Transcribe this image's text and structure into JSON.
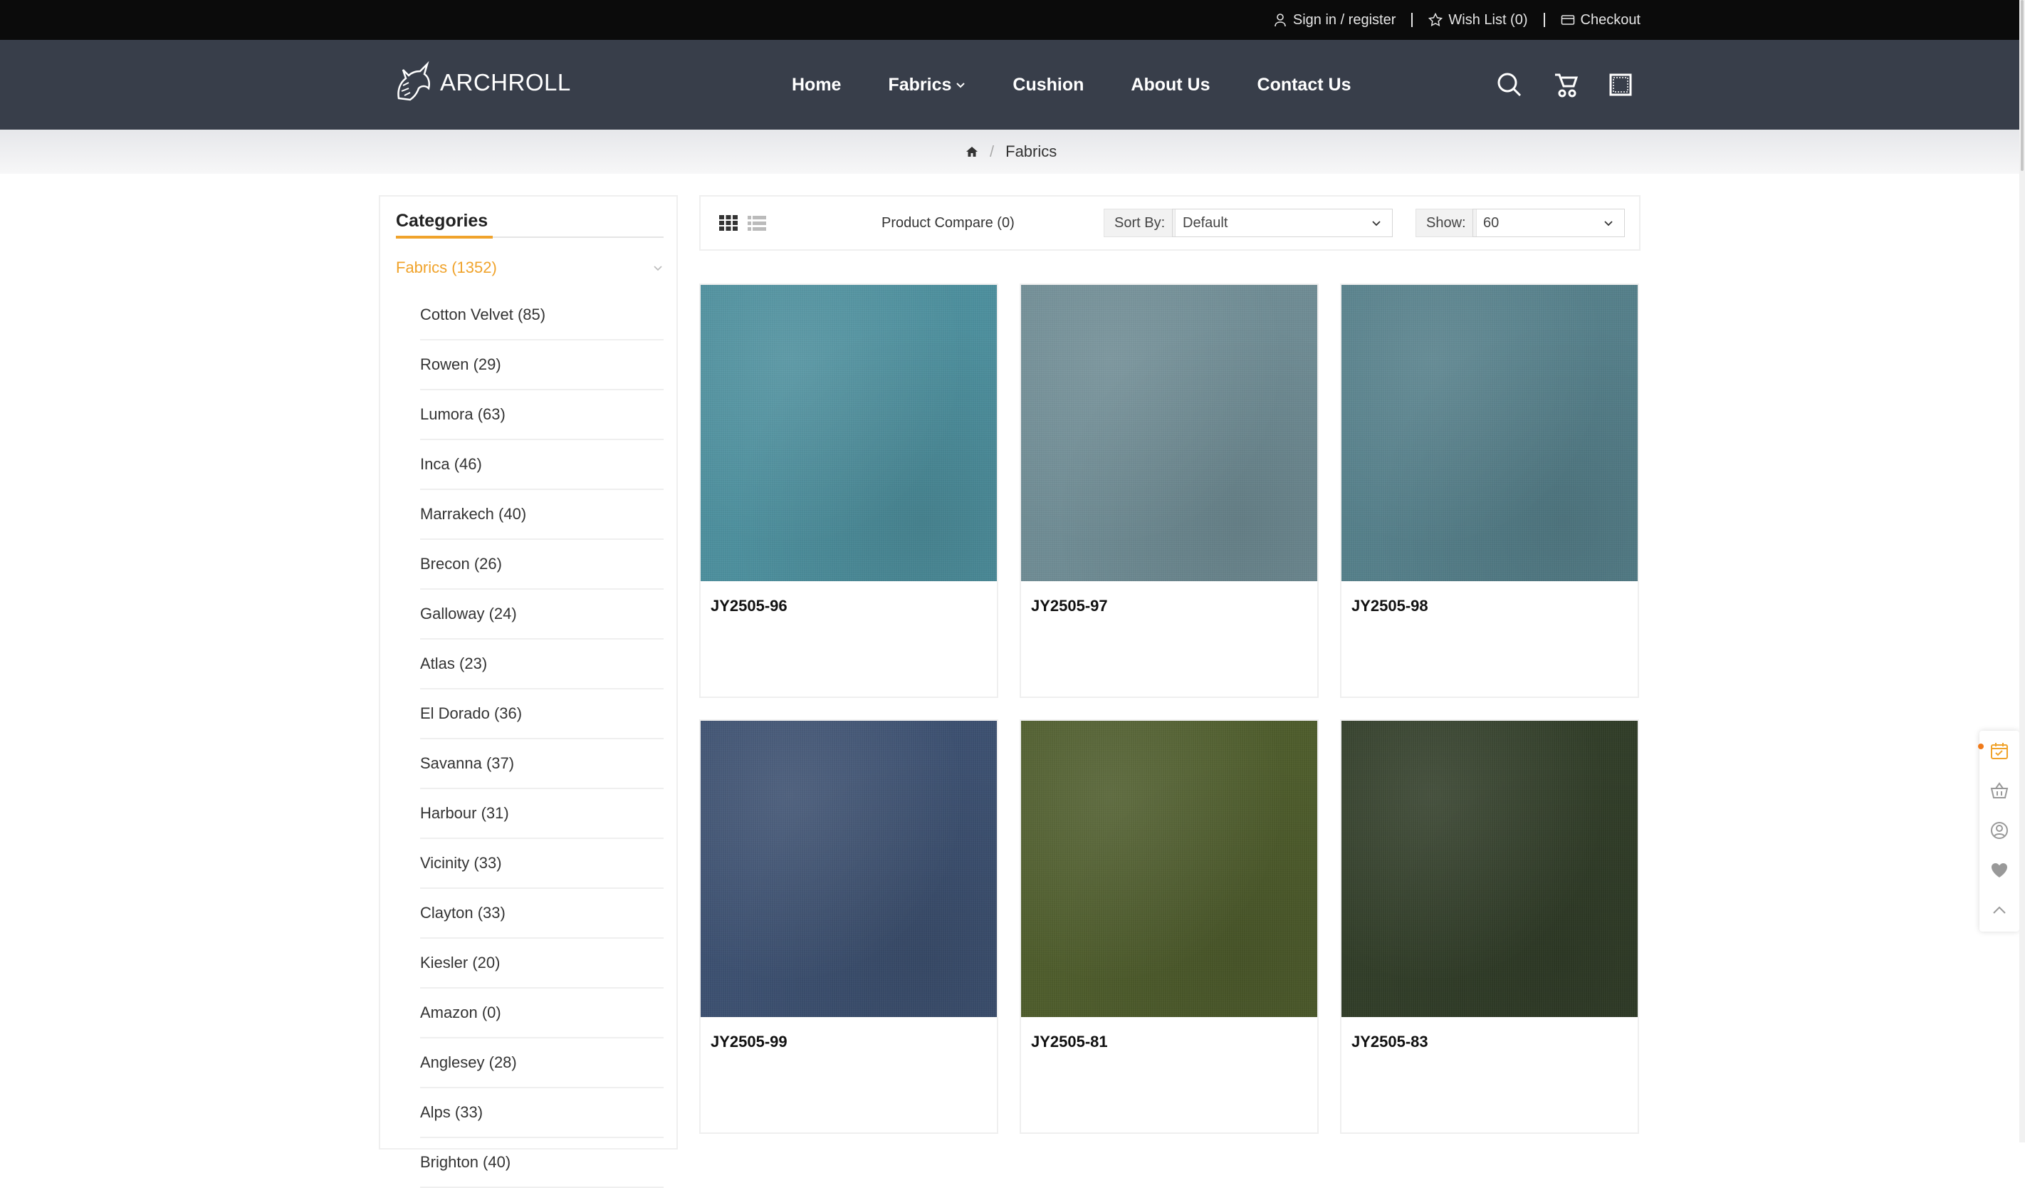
{
  "topbar": {
    "signin": "Sign in / register",
    "wishlist": "Wish List (0)",
    "checkout": "Checkout"
  },
  "header": {
    "logo_text": "ARCHROLL",
    "menu": [
      "Home",
      "Fabrics",
      "Cushion",
      "About Us",
      "Contact Us"
    ]
  },
  "breadcrumb": {
    "current": "Fabrics"
  },
  "sidebar": {
    "title": "Categories",
    "active": "Fabrics (1352)",
    "items": [
      "Cotton Velvet (85)",
      "Rowen (29)",
      "Lumora (63)",
      "Inca (46)",
      "Marrakech (40)",
      "Brecon (26)",
      "Galloway (24)",
      "Atlas (23)",
      "El Dorado (36)",
      "Savanna (37)",
      "Harbour (31)",
      "Vicinity (33)",
      "Clayton (33)",
      "Kiesler (20)",
      "Amazon (0)",
      "Anglesey (28)",
      "Alps (33)",
      "Brighton (40)"
    ]
  },
  "toolbar": {
    "compare": "Product Compare (0)",
    "sort_label": "Sort By:",
    "sort_value": "Default",
    "show_label": "Show:",
    "show_value": "60"
  },
  "products": [
    {
      "name": "JY2505-96",
      "color": "#4d8f9d"
    },
    {
      "name": "JY2505-97",
      "color": "#6f8c94"
    },
    {
      "name": "JY2505-98",
      "color": "#557f8a"
    },
    {
      "name": "JY2505-99",
      "color": "#3c5070"
    },
    {
      "name": "JY2505-81",
      "color": "#4e5c2c"
    },
    {
      "name": "JY2505-83",
      "color": "#313d28"
    }
  ],
  "colors": {
    "accent": "#f0a32b",
    "nav_bg": "#383e4a",
    "topbar_bg": "#0b0b0b"
  }
}
